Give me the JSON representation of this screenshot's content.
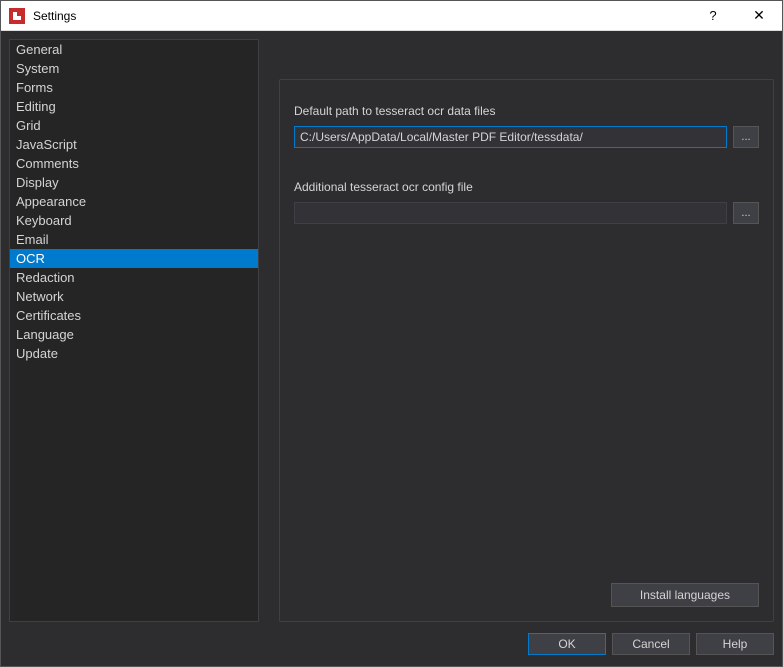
{
  "titlebar": {
    "title": "Settings",
    "help_symbol": "?",
    "close_symbol": "✕"
  },
  "sidebar": {
    "items": [
      {
        "label": "General",
        "name": "sidebar-item-general",
        "selected": false
      },
      {
        "label": "System",
        "name": "sidebar-item-system",
        "selected": false
      },
      {
        "label": "Forms",
        "name": "sidebar-item-forms",
        "selected": false
      },
      {
        "label": "Editing",
        "name": "sidebar-item-editing",
        "selected": false
      },
      {
        "label": "Grid",
        "name": "sidebar-item-grid",
        "selected": false
      },
      {
        "label": "JavaScript",
        "name": "sidebar-item-javascript",
        "selected": false
      },
      {
        "label": "Comments",
        "name": "sidebar-item-comments",
        "selected": false
      },
      {
        "label": "Display",
        "name": "sidebar-item-display",
        "selected": false
      },
      {
        "label": "Appearance",
        "name": "sidebar-item-appearance",
        "selected": false
      },
      {
        "label": "Keyboard",
        "name": "sidebar-item-keyboard",
        "selected": false
      },
      {
        "label": "Email",
        "name": "sidebar-item-email",
        "selected": false
      },
      {
        "label": "OCR",
        "name": "sidebar-item-ocr",
        "selected": true
      },
      {
        "label": "Redaction",
        "name": "sidebar-item-redaction",
        "selected": false
      },
      {
        "label": "Network",
        "name": "sidebar-item-network",
        "selected": false
      },
      {
        "label": "Certificates",
        "name": "sidebar-item-certificates",
        "selected": false
      },
      {
        "label": "Language",
        "name": "sidebar-item-language",
        "selected": false
      },
      {
        "label": "Update",
        "name": "sidebar-item-update",
        "selected": false
      }
    ]
  },
  "content": {
    "tess_path_label": "Default path to tesseract ocr data files",
    "tess_path_value": "C:/Users/AppData/Local/Master PDF Editor/tessdata/",
    "config_file_label": "Additional tesseract ocr config file",
    "config_file_value": "",
    "browse_label": "...",
    "install_languages_label": "Install languages"
  },
  "footer": {
    "ok_label": "OK",
    "cancel_label": "Cancel",
    "help_label": "Help"
  }
}
